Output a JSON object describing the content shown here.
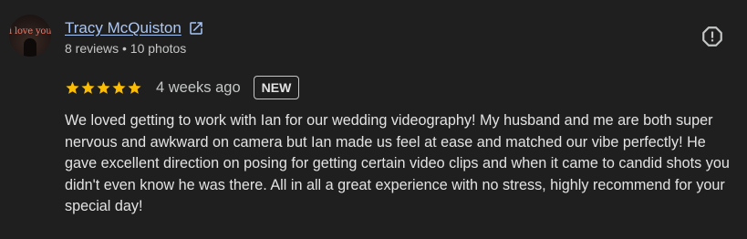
{
  "reviewer": {
    "avatar_text": "i love you",
    "name": "Tracy McQuiston",
    "meta": "8 reviews • 10 photos"
  },
  "review": {
    "rating": 5,
    "rating_max": 5,
    "date": "4 weeks ago",
    "badge": "NEW",
    "text": "We loved getting to work with Ian for our wedding videography! My husband and me are both super nervous and awkward on camera but Ian made us feel at ease and matched our vibe perfectly! He gave excellent direction on posing for getting certain video clips and when it came to candid shots you didn't even know he was there. All in all a great experience with no stress, highly recommend for your special day!"
  },
  "icons": {
    "external_link": "open-in-new-icon",
    "report": "report-icon",
    "star": "star-icon"
  },
  "colors": {
    "background": "#1f1f1f",
    "link": "#a8c7fa",
    "star": "#fbbc04",
    "text": "#e3e3e3",
    "secondary_text": "#c4c7c5"
  }
}
